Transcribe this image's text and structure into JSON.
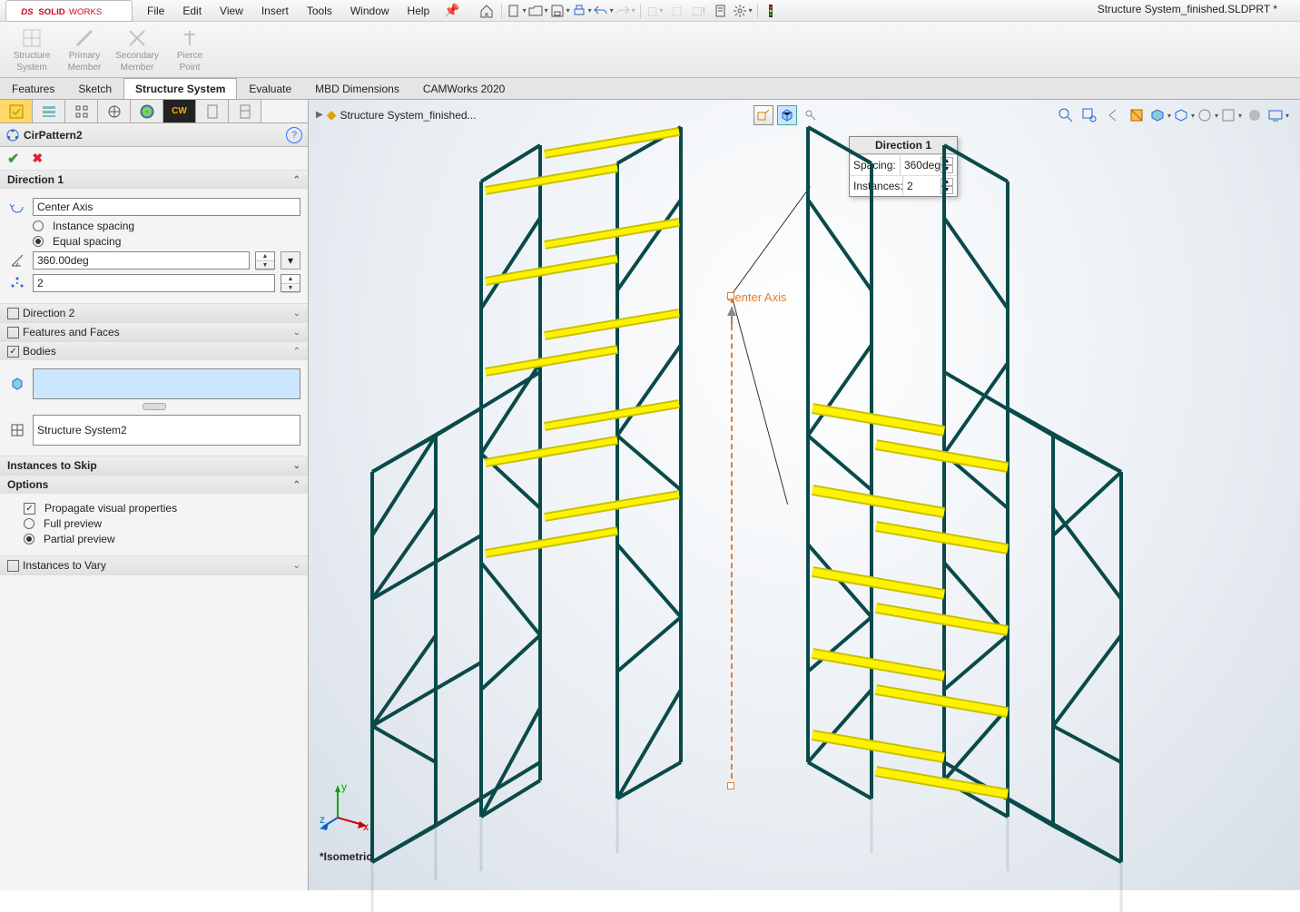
{
  "app": {
    "title": "Structure System_finished.SLDPRT *"
  },
  "menu": {
    "file": "File",
    "edit": "Edit",
    "view": "View",
    "insert": "Insert",
    "tools": "Tools",
    "window": "Window",
    "help": "Help"
  },
  "ribbon": {
    "btn1a": "Structure",
    "btn1b": "System",
    "btn2a": "Primary",
    "btn2b": "Member",
    "btn3a": "Secondary",
    "btn3b": "Member",
    "btn4a": "Pierce",
    "btn4b": "Point"
  },
  "tabs": {
    "t1": "Features",
    "t2": "Sketch",
    "t3": "Structure System",
    "t4": "Evaluate",
    "t5": "MBD Dimensions",
    "t6": "CAMWorks 2020"
  },
  "breadcrumb": "Structure System_finished...",
  "pm": {
    "title": "CirPattern2",
    "dir1": "Direction 1",
    "axis": "Center Axis",
    "instSpacing": "Instance spacing",
    "equalSpacing": "Equal spacing",
    "angle": "360.00deg",
    "count": "2",
    "dir2": "Direction 2",
    "ff": "Features and Faces",
    "bodies": "Bodies",
    "bodiesVal": "",
    "structSys": "Structure System2",
    "skip": "Instances to Skip",
    "options": "Options",
    "propagate": "Propagate visual properties",
    "full": "Full preview",
    "partial": "Partial preview",
    "vary": "Instances to Vary"
  },
  "callout": {
    "title": "Direction 1",
    "spacingL": "Spacing:",
    "spacingV": "360deg",
    "instL": "Instances:",
    "instV": "2"
  },
  "axisLabel": "Center Axis",
  "viewLabel": "*Isometric",
  "triad": {
    "x": "x",
    "y": "y",
    "z": "z"
  }
}
